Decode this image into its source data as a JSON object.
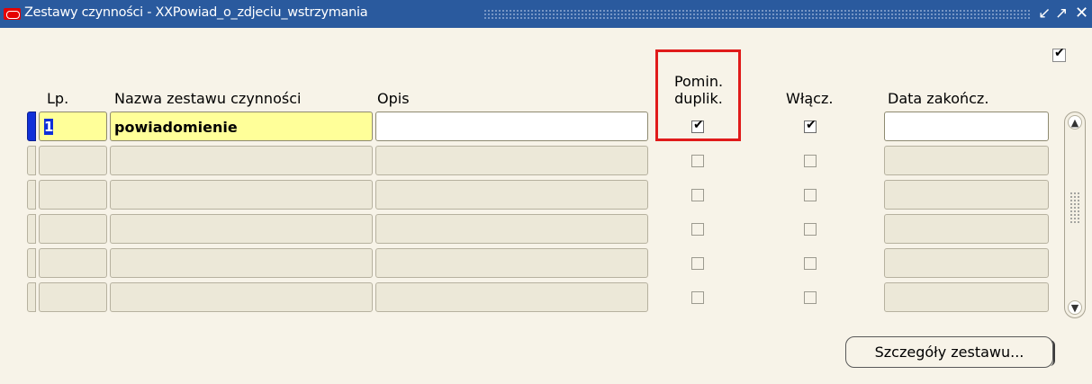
{
  "window": {
    "title": "Zestawy czynności - XXPowiad_o_zdjeciu_wstrzymania",
    "controls": {
      "minimize": "↙",
      "maximize": "↗",
      "close": "✕"
    }
  },
  "columns": {
    "lp": "Lp.",
    "name": "Nazwa zestawu czynności",
    "opis": "Opis",
    "skip_duplicates": [
      "Pomin.",
      "duplik."
    ],
    "enabled": "Włącz.",
    "end_date": "Data zakończ."
  },
  "top_checkbox_checked": true,
  "rows": [
    {
      "lp": "1",
      "name": "powiadomienie",
      "opis": "",
      "skip_duplicates": true,
      "enabled": true,
      "end_date": ""
    },
    {
      "lp": "",
      "name": "",
      "opis": "",
      "skip_duplicates": false,
      "enabled": false,
      "end_date": ""
    },
    {
      "lp": "",
      "name": "",
      "opis": "",
      "skip_duplicates": false,
      "enabled": false,
      "end_date": ""
    },
    {
      "lp": "",
      "name": "",
      "opis": "",
      "skip_duplicates": false,
      "enabled": false,
      "end_date": ""
    },
    {
      "lp": "",
      "name": "",
      "opis": "",
      "skip_duplicates": false,
      "enabled": false,
      "end_date": ""
    },
    {
      "lp": "",
      "name": "",
      "opis": "",
      "skip_duplicates": false,
      "enabled": false,
      "end_date": ""
    }
  ],
  "buttons": {
    "details": "Szczegóły zestawu..."
  },
  "icons": {
    "app": "oracle-forms-icon",
    "check": "✔"
  }
}
